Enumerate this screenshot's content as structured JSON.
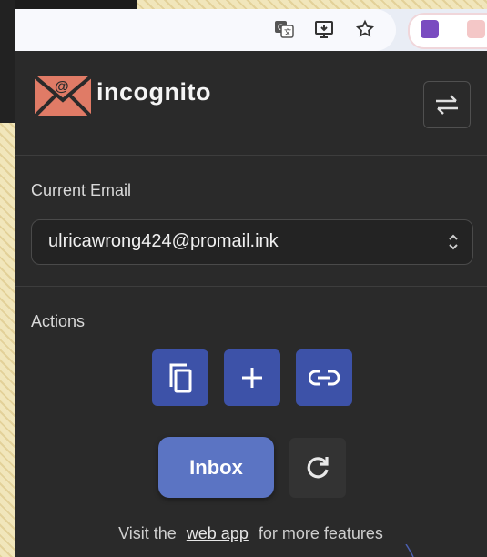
{
  "browser": {
    "icons": [
      "translate-icon",
      "install-app-icon",
      "bookmark-star-icon"
    ],
    "extensions": [
      "onenote-extension-icon",
      "incognito-extension-icon"
    ]
  },
  "popup": {
    "brand": "incognito",
    "current_email_label": "Current Email",
    "current_email": "ulricawrong424@promail.ink",
    "actions_label": "Actions",
    "actions": [
      {
        "name": "copy-email",
        "icon": "copy-icon"
      },
      {
        "name": "new-email",
        "icon": "plus-icon"
      },
      {
        "name": "share-link",
        "icon": "link-icon"
      }
    ],
    "inbox_label": "Inbox",
    "refresh_icon": "refresh-icon",
    "footer": {
      "prefix": "Visit the",
      "link": "web app",
      "suffix": "for more features"
    }
  },
  "colors": {
    "popup_bg": "#2a2a2a",
    "action_button": "#3d52a8",
    "inbox_button": "#5b74c3",
    "logo_envelope": "#e07b66"
  }
}
